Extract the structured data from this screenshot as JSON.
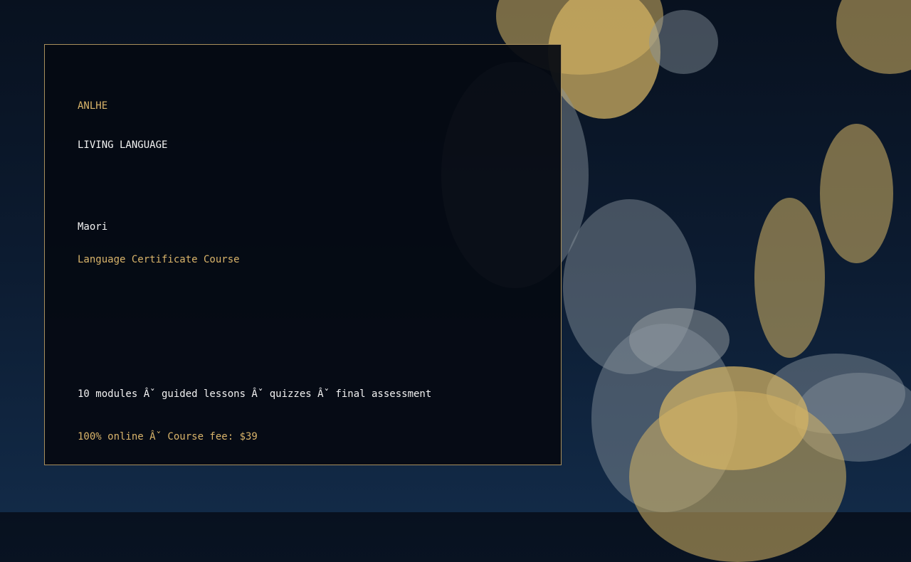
{
  "brand": "ANLHE",
  "tagline": "LIVING LANGUAGE",
  "language": "Maori",
  "course_title": "Language Certificate Course",
  "features_line": "10 modules Âˇ guided lessons Âˇ quizzes Âˇ final assessment",
  "fee_line": "100% online Âˇ Course fee: $39",
  "colors": {
    "accent": "#d9b46a",
    "text": "#f2f2f2",
    "border": "#a88f5c",
    "background": "#0c1b30"
  }
}
